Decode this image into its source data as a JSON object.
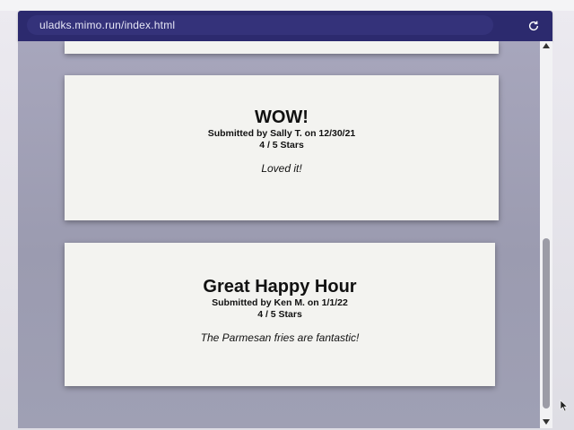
{
  "browser": {
    "url": "uladks.mimo.run/index.html",
    "reload_icon": "reload-icon"
  },
  "reviews": [
    {
      "title": "WOW!",
      "submitted_by": "Submitted by Sally T. on 12/30/21",
      "rating": "4 / 5 Stars",
      "rating_value": 4,
      "rating_max": 5,
      "body": "Loved it!"
    },
    {
      "title": "Great Happy Hour",
      "submitted_by": "Submitted by Ken M. on 1/1/22",
      "rating": "4 / 5 Stars",
      "rating_value": 4,
      "rating_max": 5,
      "body": "The Parmesan fries are fantastic!"
    }
  ],
  "colors": {
    "browser_bar": "#2c2a6e",
    "page_background": "#a3a2b8",
    "card_background": "#f3f3f0"
  }
}
